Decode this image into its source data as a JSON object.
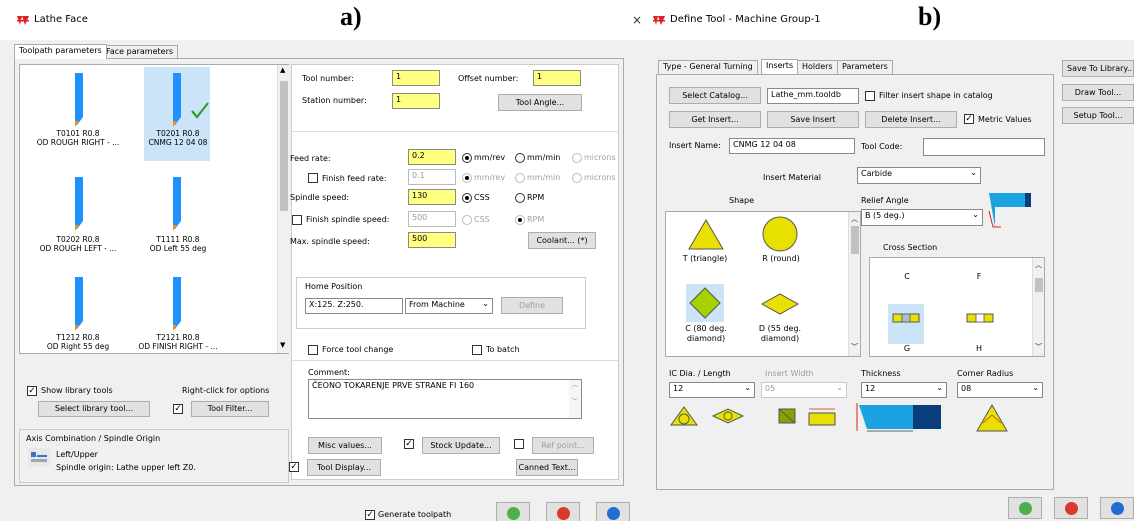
{
  "left": {
    "title": "Lathe Face",
    "panel_label": "a)",
    "close": "×",
    "tabs": [
      "Toolpath parameters",
      "Face parameters"
    ],
    "tools": [
      {
        "name": "T0101 R0.8",
        "desc": "OD ROUGH RIGHT - ..."
      },
      {
        "name": "T0201 R0.8",
        "desc": "CNMG 12 04 08"
      },
      {
        "name": "T0202 R0.8",
        "desc": "OD ROUGH LEFT - ..."
      },
      {
        "name": "T1111 R0.8",
        "desc": "OD Left 55 deg"
      },
      {
        "name": "T1212 R0.8",
        "desc": "OD Right 55 deg"
      },
      {
        "name": "T2121 R0.8",
        "desc": "OD FINISH RIGHT - ..."
      }
    ],
    "show_library_tools": "Show library tools",
    "right_click": "Right-click for options",
    "select_library_tool": "Select library tool...",
    "tool_filter": "Tool Filter...",
    "axis_combo_title": "Axis Combination / Spindle Origin",
    "axis_combo_value": "Left/Upper",
    "spindle_origin": "Spindle origin: Lathe upper left  Z0.",
    "tool_number_label": "Tool number:",
    "tool_number": "1",
    "offset_number_label": "Offset number:",
    "offset_number": "1",
    "station_number_label": "Station number:",
    "station_number": "1",
    "tool_angle": "Tool Angle...",
    "feed_rate_label": "Feed rate:",
    "feed_rate": "0.2",
    "unit_mmrev": "mm/rev",
    "unit_mmmin": "mm/min",
    "unit_microns": "microns",
    "finish_feed_label": "Finish feed rate:",
    "finish_feed": "0.1",
    "spindle_speed_label": "Spindle speed:",
    "spindle_speed": "130",
    "css": "CSS",
    "rpm": "RPM",
    "finish_spindle_label": "Finish spindle speed:",
    "finish_spindle": "500",
    "max_spindle_label": "Max. spindle speed:",
    "max_spindle": "500",
    "coolant": "Coolant... (*)",
    "home_position_title": "Home Position",
    "home_position_value": "X:125.  Z:250.",
    "from_machine": "From Machine",
    "define": "Define",
    "force_tool_change": "Force tool change",
    "to_batch": "To batch",
    "comment_label": "Comment:",
    "comment": "ČEONO TOKARENJE PRVE STRANE FI 160",
    "misc_values": "Misc values...",
    "stock_update": "Stock Update...",
    "ref_point": "Ref point...",
    "tool_display": "Tool Display...",
    "canned_text": "Canned Text...",
    "generate_toolpath": "Generate toolpath"
  },
  "right": {
    "title": "Define Tool - Machine Group-1",
    "panel_label": "b)",
    "tabs": [
      "Type - General Turning",
      "Inserts",
      "Holders",
      "Parameters"
    ],
    "select_catalog": "Select Catalog...",
    "catalog_file": "Lathe_mm.tooldb",
    "filter_insert": "Filter insert shape in catalog",
    "get_insert": "Get Insert...",
    "save_insert": "Save Insert",
    "delete_insert": "Delete Insert...",
    "metric_values": "Metric Values",
    "insert_name_label": "Insert Name:",
    "insert_name": "CNMG 12 04 08",
    "tool_code_label": "Tool Code:",
    "tool_code": "",
    "insert_material_label": "Insert Material",
    "insert_material": "Carbide",
    "shape_label": "Shape",
    "shapes": [
      "T (triangle)",
      "R (round)",
      "C (80 deg. diamond)",
      "D (55 deg. diamond)"
    ],
    "relief_angle_label": "Relief Angle",
    "relief_angle": "B (5 deg.)",
    "cross_section_label": "Cross Section",
    "cross_sections": [
      "C",
      "F",
      "G",
      "H"
    ],
    "ic_dia_label": "IC Dia. / Length",
    "ic_dia": "12",
    "insert_width_label": "Insert Width",
    "insert_width": "05",
    "thickness_label": "Thickness",
    "thickness": "12",
    "corner_radius_label": "Corner Radius",
    "corner_radius": "08",
    "side_buttons": [
      "Save To Library...",
      "Draw Tool...",
      "Setup Tool..."
    ]
  },
  "colors": {
    "accent_yellow": "#ffff80",
    "ok_green": "#4caf50",
    "cancel_red": "#d83b2b",
    "help_blue": "#1f6fd1",
    "tool_blue": "#1e90ff",
    "selection": "#cce4f7",
    "insert_yellow": "#e8e000"
  }
}
